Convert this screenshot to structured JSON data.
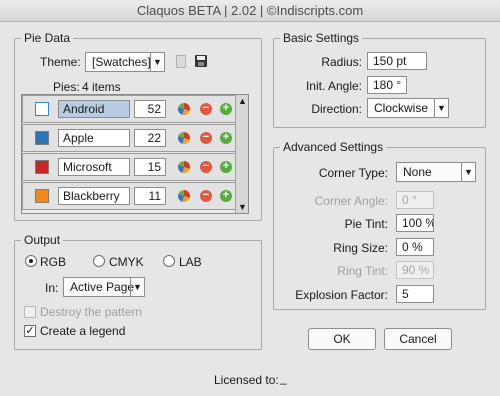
{
  "window": {
    "title": "Claquos BETA  |  2.02  |  ©Indiscripts.com"
  },
  "pie_data": {
    "legend": "Pie Data",
    "theme_label": "Theme:",
    "theme_value": "[Swatches]",
    "pies_label": "Pies:",
    "pies_count": "4 items",
    "items": [
      {
        "name": "Android",
        "value": "52",
        "color": "#ffffff"
      },
      {
        "name": "Apple",
        "value": "22",
        "color": "#2f74b5"
      },
      {
        "name": "Microsoft",
        "value": "15",
        "color": "#c7262b"
      },
      {
        "name": "Blackberry",
        "value": "11",
        "color": "#f08a1f"
      }
    ]
  },
  "output": {
    "legend": "Output",
    "rgb": "RGB",
    "cmyk": "CMYK",
    "lab": "LAB",
    "in_label": "In:",
    "in_value": "Active Page",
    "destroy": "Destroy the pattern",
    "legend_check": "Create a legend"
  },
  "basic": {
    "legend": "Basic Settings",
    "radius_label": "Radius:",
    "radius_value": "150 pt",
    "angle_label": "Init. Angle:",
    "angle_value": "180 °",
    "direction_label": "Direction:",
    "direction_value": "Clockwise"
  },
  "advanced": {
    "legend": "Advanced Settings",
    "corner_type_label": "Corner Type:",
    "corner_type_value": "None",
    "corner_angle_label": "Corner Angle:",
    "corner_angle_value": "0 °",
    "pie_tint_label": "Pie Tint:",
    "pie_tint_value": "100 %",
    "ring_size_label": "Ring Size:",
    "ring_size_value": "0 %",
    "ring_tint_label": "Ring Tint:",
    "ring_tint_value": "90 %",
    "explosion_label": "Explosion Factor:",
    "explosion_value": "5"
  },
  "buttons": {
    "ok": "OK",
    "cancel": "Cancel"
  },
  "footer": {
    "licensed": "Licensed to:",
    "licensee": "_"
  }
}
